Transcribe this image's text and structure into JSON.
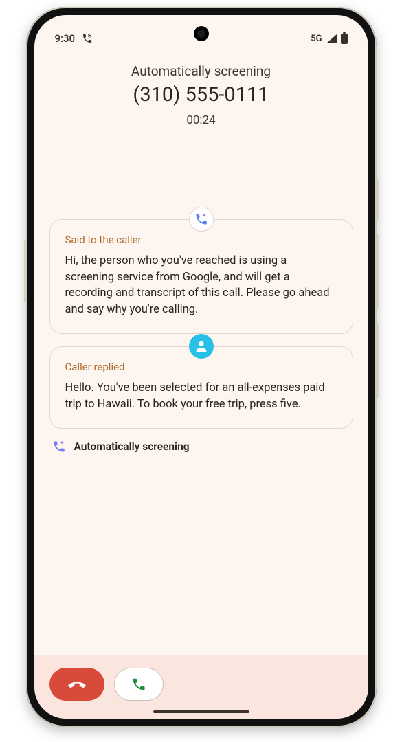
{
  "status_bar": {
    "time": "9:30",
    "network_label": "5G"
  },
  "header": {
    "status_line": "Automatically screening",
    "phone_number": "(310) 555-0111",
    "call_timer": "00:24"
  },
  "transcript": {
    "said_to_caller": {
      "label": "Said to the caller",
      "body": "Hi, the person who you've reached is using a screening service from Google, and will get a recording and transcript of this call. Please go ahead and say why you're calling."
    },
    "caller_replied": {
      "label": "Caller replied",
      "body": "Hello. You've been selected for an all-expenses paid trip to Hawaii. To book your free trip, press five."
    }
  },
  "footer": {
    "screening_status": "Automatically screening"
  }
}
